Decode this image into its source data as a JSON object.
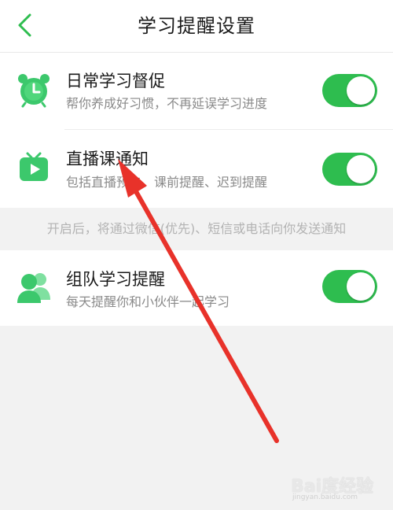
{
  "header": {
    "title": "学习提醒设置",
    "back_icon": "chevron-left-icon",
    "accent_color": "#2ebd4f"
  },
  "settings": [
    {
      "icon": "alarm-clock-icon",
      "title": "日常学习督促",
      "subtitle": "帮你养成好习惯，不再延误学习进度",
      "enabled": true
    },
    {
      "icon": "tv-play-icon",
      "title": "直播课通知",
      "subtitle": "包括直播预告、课前提醒、迟到提醒",
      "enabled": true
    },
    {
      "icon": "group-users-icon",
      "title": "组队学习提醒",
      "subtitle": "每天提醒你和小伙伴一起学习",
      "enabled": true
    }
  ],
  "hint": "开启后，将通过微信(优先)、短信或电话向你发送通知",
  "colors": {
    "toggle_on": "#2ebd4f",
    "icon_green": "#3cc86c",
    "annotation_arrow": "#e8322a"
  },
  "watermark": {
    "main": "Bai度经验",
    "sub": "jingyan.baidu.com"
  }
}
